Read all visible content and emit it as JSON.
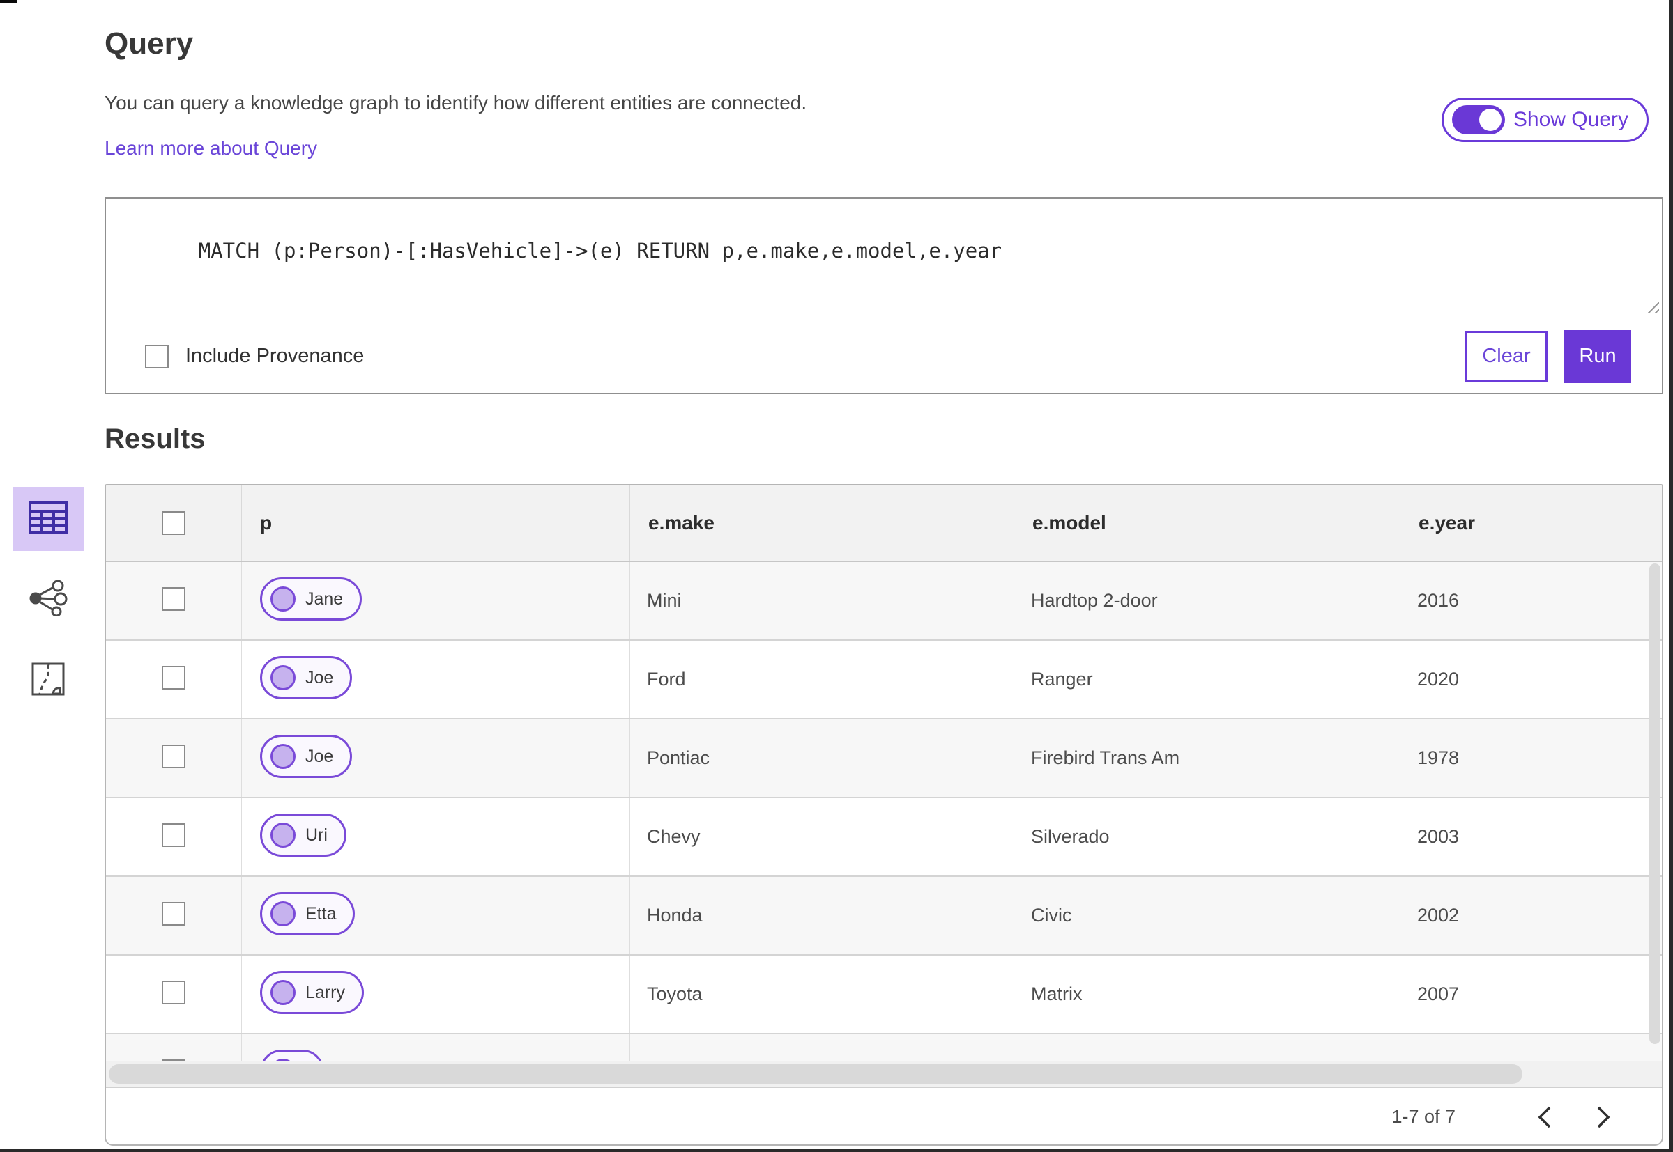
{
  "page": {
    "title": "Query",
    "description": "You can query a knowledge graph to identify how different entities are connected.",
    "learn_more_link": "Learn more about Query",
    "show_query_label": "Show Query",
    "results_title": "Results"
  },
  "query_editor": {
    "query_text": "MATCH (p:Person)-[:HasVehicle]->(e) RETURN p,e.make,e.model,e.year",
    "include_provenance_label": "Include Provenance",
    "include_provenance_checked": false,
    "clear_label": "Clear",
    "run_label": "Run"
  },
  "view_switcher": {
    "items": [
      {
        "name": "table-view",
        "icon": "table-icon",
        "selected": true
      },
      {
        "name": "link-chart-view",
        "icon": "link-chart-icon",
        "selected": false
      },
      {
        "name": "map-view",
        "icon": "map-icon",
        "selected": false
      }
    ]
  },
  "results_table": {
    "columns": [
      "p",
      "e.make",
      "e.model",
      "e.year"
    ],
    "rows": [
      {
        "p": "Jane",
        "make": "Mini",
        "model": "Hardtop 2-door",
        "year": "2016"
      },
      {
        "p": "Joe",
        "make": "Ford",
        "model": "Ranger",
        "year": "2020"
      },
      {
        "p": "Joe",
        "make": "Pontiac",
        "model": "Firebird Trans Am",
        "year": "1978"
      },
      {
        "p": "Uri",
        "make": "Chevy",
        "model": "Silverado",
        "year": "2003"
      },
      {
        "p": "Etta",
        "make": "Honda",
        "model": "Civic",
        "year": "2002"
      },
      {
        "p": "Larry",
        "make": "Toyota",
        "model": "Matrix",
        "year": "2007"
      },
      {
        "p": "",
        "make": "",
        "model": "",
        "year": "",
        "partial": true
      }
    ],
    "pagination": {
      "range_label": "1-7 of 7"
    }
  },
  "colors": {
    "accent_purple": "#6a38d6",
    "accent_purple_border": "#6a3ad9",
    "pill_border": "#7a4ad8",
    "pill_dot_fill": "#c6b2ee",
    "selected_view_bg": "#d8c8f6",
    "header_row_bg": "#f2f2f2",
    "stripe_row_bg": "#f7f7f7"
  }
}
